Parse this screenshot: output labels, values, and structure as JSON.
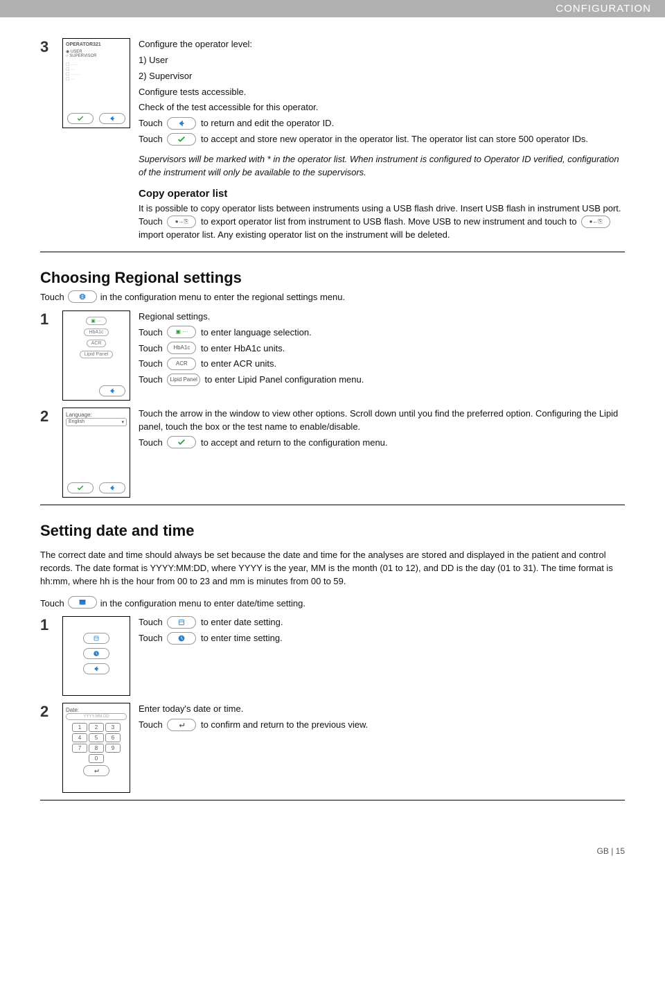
{
  "header": {
    "title": "CONFIGURATION"
  },
  "step3": {
    "num": "3",
    "screen": {
      "title": "OPERATOR321",
      "opt_user": "USER",
      "opt_sup": "SUPERVISOR"
    },
    "lines": {
      "l1": "Configure the operator level:",
      "l2": "1) User",
      "l3": "2) Supervisor",
      "l4": "Configure tests accessible.",
      "l5": "Check of the test accessible for this operator.",
      "l6a": "Touch",
      "l6b": "to return and edit the operator ID.",
      "l7a": "Touch",
      "l7b": "to accept and store new operator in the operator list. The operator list can store 500 operator IDs."
    },
    "note": "Supervisors will be marked with * in the operator list. When instrument is configured to Operator ID verified, configuration of the instrument will only be available to the supervisors."
  },
  "copy": {
    "heading": "Copy operator list",
    "body_a": "It is possible to copy operator lists between instruments using a USB flash drive. Insert USB flash in instrument USB port. Touch",
    "body_b": "to export operator list from instrument to USB flash. Move USB to new instrument and touch to",
    "body_c": "import operator list. Any existing operator list on the instrument will be deleted."
  },
  "regional": {
    "heading": "Choosing Regional settings",
    "intro_a": "Touch",
    "intro_b": "in the configuration menu to enter the regional settings menu.",
    "s1": {
      "num": "1",
      "l1": "Regional settings.",
      "l2a": "Touch",
      "l2b": "to enter language selection.",
      "l3a": "Touch",
      "l3b": "to enter HbA1c units.",
      "l4a": "Touch",
      "l4b": "to enter ACR units.",
      "l5a": "Touch",
      "l5b": "to enter Lipid Panel configuration menu.",
      "btn_hba1c": "HbA1c",
      "btn_acr": "ACR",
      "btn_lipid": "Lipid Panel"
    },
    "s2": {
      "num": "2",
      "screen_label": "Language:",
      "screen_value": "English",
      "l1": "Touch the arrow in the window to view other options. Scroll down until you find the preferred option. Configuring the Lipid panel, touch the box or the test name to enable/disable.",
      "l2a": "Touch",
      "l2b": "to accept and return to the configuration menu."
    }
  },
  "datetime": {
    "heading": "Setting date and time",
    "intro": "The correct date and time should always be set because the date and time for the analyses are stored and displayed in the patient and control records. The date format is YYYY:MM:DD, where YYYY is the year, MM is the month (01 to 12), and DD is the day (01 to 31). The time format is hh:mm, where hh is the hour from 00 to 23 and mm is minutes from 00 to 59.",
    "touch_a": "Touch",
    "touch_b": "in the configuration menu to enter date/time setting.",
    "s1": {
      "num": "1",
      "l1a": "Touch",
      "l1b": "to enter date setting.",
      "l2a": "Touch",
      "l2b": "to enter time setting."
    },
    "s2": {
      "num": "2",
      "screen_label": "Date:",
      "screen_ph": "YYYY.MM.DD",
      "l1": "Enter today's date or time.",
      "l2a": "Touch",
      "l2b": "to confirm and return to the previous view.",
      "keys": [
        "1",
        "2",
        "3",
        "4",
        "5",
        "6",
        "7",
        "8",
        "9",
        "",
        "0",
        ""
      ]
    }
  },
  "footer": {
    "label": "GB  |  15"
  }
}
